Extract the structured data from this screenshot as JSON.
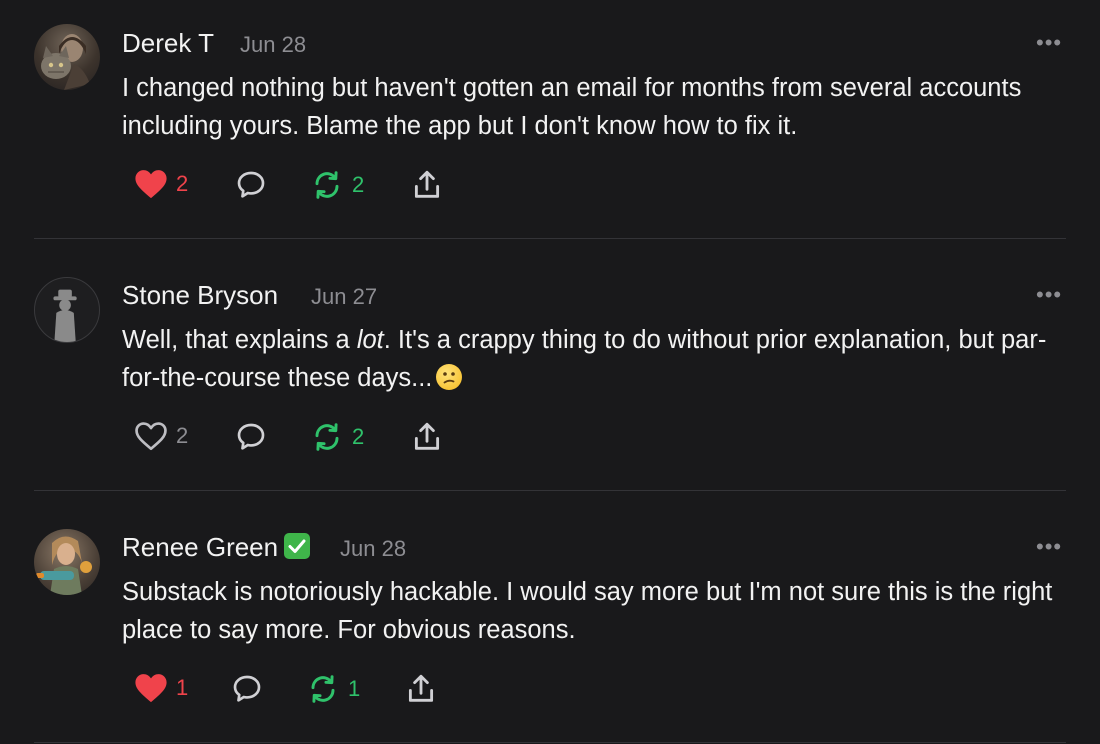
{
  "comments": [
    {
      "author": "Derek T",
      "date": "Jun 28",
      "text": "I changed nothing but haven't gotten an email for months from several accounts including yours. Blame the app but I don't know how to fix it.",
      "likes": "2",
      "liked": true,
      "restacks": "2",
      "avatar_icon": "cat-woman-avatar"
    },
    {
      "author": "Stone Bryson",
      "date": "Jun 27",
      "text_before": "Well, that explains a ",
      "text_italic": "lot",
      "text_after": ". It's a crappy thing to do without prior explanation, but par-for-the-course these days...",
      "emoji": "confused-face",
      "likes": "2",
      "liked": false,
      "restacks": "2",
      "avatar_icon": "silhouette-avatar"
    },
    {
      "author": "Renee Green",
      "verified_icon": "check-mark-button",
      "date": "Jun 28",
      "text": "Substack is notoriously hackable. I would say more but I'm not sure this is the right place to say more. For obvious reasons.",
      "likes": "1",
      "liked": true,
      "restacks": "1",
      "avatar_icon": "woman-with-blaster-avatar"
    }
  ],
  "more_label": "•••",
  "colors": {
    "background": "#19191b",
    "like_active": "#f0434b",
    "restack": "#2fc26b",
    "muted": "#8d8d92"
  },
  "icons": [
    "heart-icon",
    "comment-icon",
    "restack-icon",
    "share-icon",
    "more-icon"
  ]
}
